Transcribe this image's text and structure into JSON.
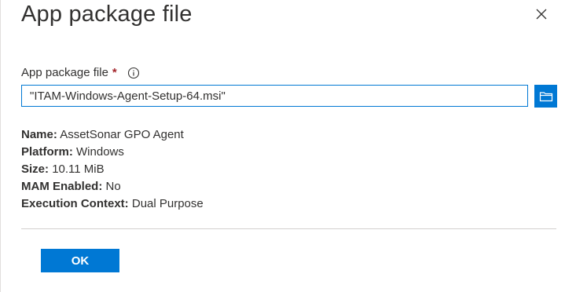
{
  "header": {
    "title": "App package file",
    "close_icon": "close-icon"
  },
  "form": {
    "label": "App package file",
    "required_marker": "*",
    "info_icon": "info-icon",
    "file_value": "\"ITAM-Windows-Agent-Setup-64.msi\"",
    "browse_icon": "folder-icon"
  },
  "details": {
    "name_label": "Name:",
    "name_value": "AssetSonar GPO Agent",
    "platform_label": "Platform:",
    "platform_value": "Windows",
    "size_label": "Size:",
    "size_value": "10.11 MiB",
    "mam_label": "MAM Enabled:",
    "mam_value": "No",
    "context_label": "Execution Context:",
    "context_value": "Dual Purpose"
  },
  "footer": {
    "ok_label": "OK"
  },
  "colors": {
    "accent": "#0078d4",
    "required": "#a4262c",
    "text": "#323130"
  }
}
